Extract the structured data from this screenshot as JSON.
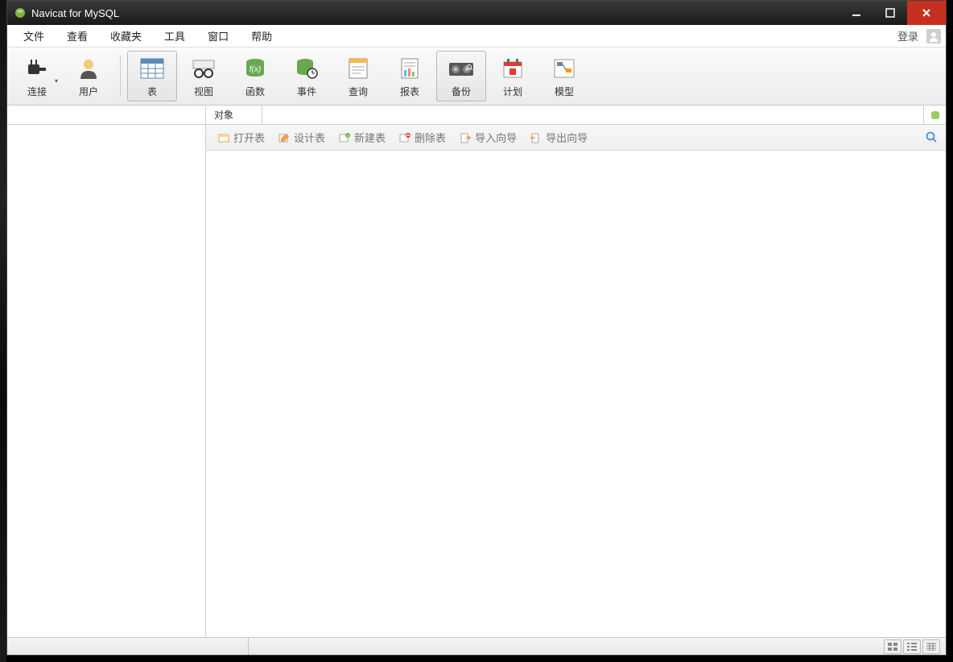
{
  "window": {
    "title": "Navicat for MySQL"
  },
  "menubar": {
    "items": [
      "文件",
      "查看",
      "收藏夹",
      "工具",
      "窗口",
      "帮助"
    ],
    "login": "登录"
  },
  "toolbar": {
    "connect": "连接",
    "user": "用户",
    "table": "表",
    "view": "视图",
    "function": "函数",
    "event": "事件",
    "query": "查询",
    "report": "报表",
    "backup": "备份",
    "schedule": "计划",
    "model": "模型"
  },
  "objectbar": {
    "tab": "对象"
  },
  "actionbar": {
    "open_table": "打开表",
    "design_table": "设计表",
    "new_table": "新建表",
    "delete_table": "删除表",
    "import_wizard": "导入向导",
    "export_wizard": "导出向导"
  }
}
